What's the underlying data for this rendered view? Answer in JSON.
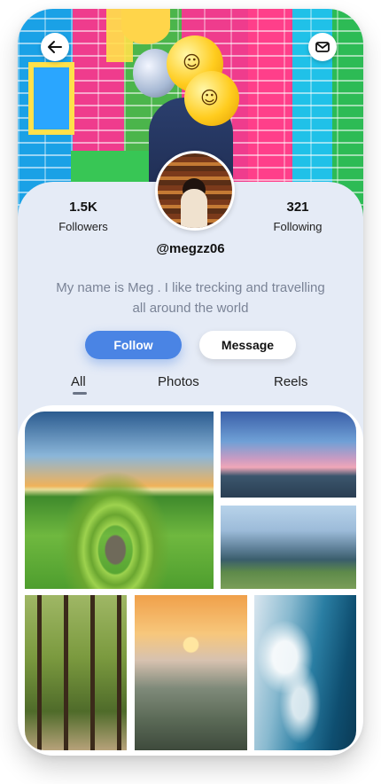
{
  "profile": {
    "followers_count": "1.5K",
    "followers_label": "Followers",
    "following_count": "321",
    "following_label": "Following",
    "username": "@megzz06",
    "bio": "My name is Meg . I like trecking and travelling all around the world"
  },
  "actions": {
    "follow_label": "Follow",
    "message_label": "Message"
  },
  "tabs": [
    {
      "label": "All",
      "active": true
    },
    {
      "label": "Photos",
      "active": false
    },
    {
      "label": "Reels",
      "active": false
    }
  ],
  "icons": {
    "back": "arrow-left-icon",
    "message": "mail-icon"
  },
  "colors": {
    "accent": "#4a84e4",
    "panel": "#e5ebf6",
    "bio_text": "#7a8396"
  },
  "gallery": [
    {
      "subject": "green valley with stone circle"
    },
    {
      "subject": "beach at dusk"
    },
    {
      "subject": "mountain meadow"
    },
    {
      "subject": "forest path"
    },
    {
      "subject": "field at sunset"
    },
    {
      "subject": "ocean waves"
    }
  ]
}
